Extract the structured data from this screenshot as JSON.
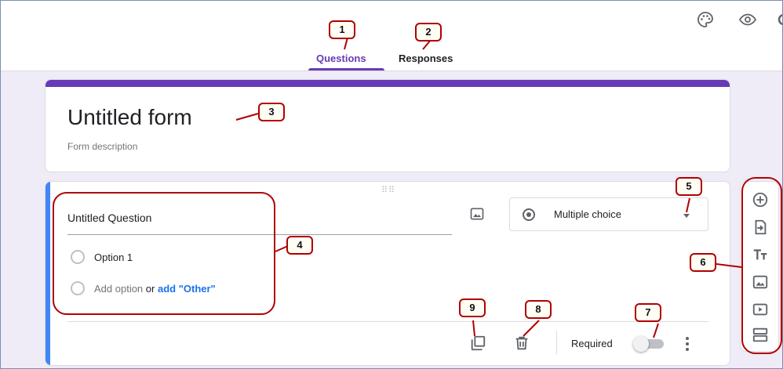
{
  "tabs": {
    "questions_label": "Questions",
    "responses_label": "Responses"
  },
  "top_icons": [
    "palette-icon",
    "eye-icon",
    "gear-icon"
  ],
  "form": {
    "title": "Untitled form",
    "description_placeholder": "Form description"
  },
  "question": {
    "title": "Untitled Question",
    "options": [
      "Option 1"
    ],
    "add_option_label": "Add option",
    "or_label": "or",
    "add_other_label": "add \"Other\"",
    "type_label": "Multiple choice",
    "required_label": "Required",
    "required_on": false
  },
  "side_toolbar": [
    "add-question-icon",
    "import-questions-icon",
    "add-title-icon",
    "add-image-icon",
    "add-video-icon",
    "add-section-icon"
  ],
  "callouts": [
    "1",
    "2",
    "3",
    "4",
    "5",
    "6",
    "7",
    "8",
    "9"
  ],
  "colors": {
    "accent": "#673ab7",
    "background": "#efebf7",
    "focus_strip": "#4285f4",
    "callout_border": "#b10000",
    "link": "#1a73e8"
  }
}
